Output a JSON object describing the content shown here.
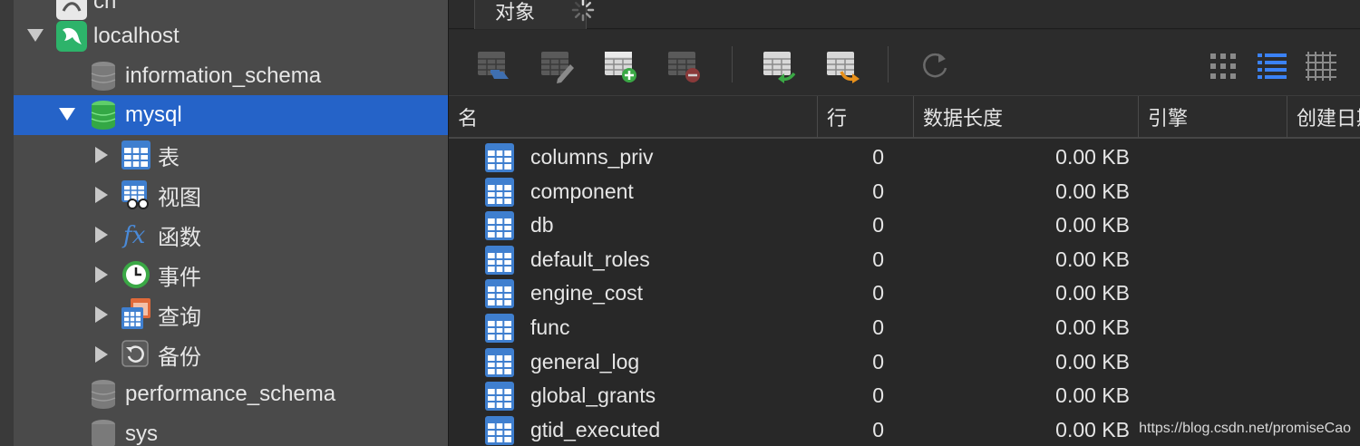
{
  "sidebar": {
    "partial_top_label": "cn",
    "connection": {
      "label": "localhost",
      "icon": "mysql-dolphin-icon"
    },
    "databases": [
      {
        "label": "information_schema",
        "icon": "database-icon",
        "selected": false
      },
      {
        "label": "mysql",
        "icon": "database-icon",
        "selected": true
      },
      {
        "label": "performance_schema",
        "icon": "database-icon",
        "selected": false
      },
      {
        "label": "sys",
        "icon": "database-icon",
        "selected": false
      }
    ],
    "mysql_children": [
      {
        "label": "表",
        "icon": "table-icon"
      },
      {
        "label": "视图",
        "icon": "view-icon"
      },
      {
        "label": "函数",
        "icon": "function-icon"
      },
      {
        "label": "事件",
        "icon": "event-clock-icon"
      },
      {
        "label": "查询",
        "icon": "query-icon"
      },
      {
        "label": "备份",
        "icon": "backup-icon"
      }
    ]
  },
  "tabs": {
    "objects": "对象"
  },
  "toolbar": {
    "buttons": [
      "open-table",
      "design-table",
      "new-table",
      "delete-table",
      "import-wizard",
      "export-wizard",
      "refresh"
    ],
    "view_modes": [
      "grid-view",
      "list-view",
      "detail-view"
    ],
    "active_view": "list-view",
    "accent": "#3b82f6"
  },
  "table": {
    "columns": [
      "名",
      "行",
      "数据长度",
      "引擎",
      "创建日期"
    ],
    "rows": [
      {
        "name": "columns_priv",
        "rows": "0",
        "size": "0.00 KB"
      },
      {
        "name": "component",
        "rows": "0",
        "size": "0.00 KB"
      },
      {
        "name": "db",
        "rows": "0",
        "size": "0.00 KB"
      },
      {
        "name": "default_roles",
        "rows": "0",
        "size": "0.00 KB"
      },
      {
        "name": "engine_cost",
        "rows": "0",
        "size": "0.00 KB"
      },
      {
        "name": "func",
        "rows": "0",
        "size": "0.00 KB"
      },
      {
        "name": "general_log",
        "rows": "0",
        "size": "0.00 KB"
      },
      {
        "name": "global_grants",
        "rows": "0",
        "size": "0.00 KB"
      },
      {
        "name": "gtid_executed",
        "rows": "0",
        "size": "0.00 KB"
      }
    ]
  },
  "watermark": "https://blog.csdn.net/promiseCao"
}
